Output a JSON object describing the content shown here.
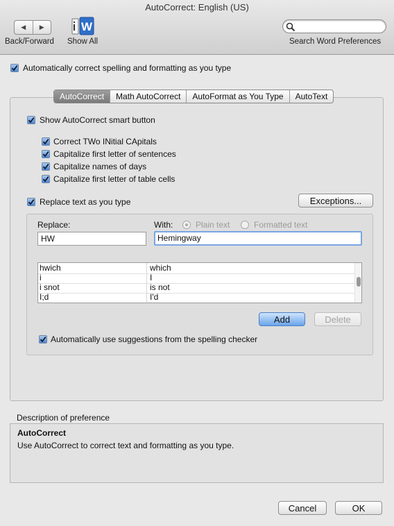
{
  "window": {
    "title": "AutoCorrect: English (US)"
  },
  "toolbar": {
    "back_forward_label": "Back/Forward",
    "back_glyph": "◀",
    "forward_glyph": "▶",
    "show_all_label": "Show All",
    "search_placeholder": "",
    "search_label": "Search Word Preferences"
  },
  "auto_correct_master": {
    "label": "Automatically correct spelling and formatting as you type",
    "checked": true
  },
  "tabs": [
    {
      "label": "AutoCorrect",
      "active": true
    },
    {
      "label": "Math AutoCorrect",
      "active": false
    },
    {
      "label": "AutoFormat as You Type",
      "active": false
    },
    {
      "label": "AutoText",
      "active": false
    }
  ],
  "options": {
    "show_smart_button": {
      "label": "Show AutoCorrect smart button",
      "checked": true
    },
    "items": [
      {
        "label": "Correct TWo INitial CApitals",
        "checked": true
      },
      {
        "label": "Capitalize first letter of sentences",
        "checked": true
      },
      {
        "label": "Capitalize names of days",
        "checked": true
      },
      {
        "label": "Capitalize first letter of table cells",
        "checked": true
      }
    ],
    "replace_text": {
      "label": "Replace text as you type",
      "checked": true
    },
    "exceptions_button": "Exceptions..."
  },
  "replace": {
    "replace_label": "Replace:",
    "with_label": "With:",
    "plain_text_label": "Plain text",
    "formatted_text_label": "Formatted text",
    "replace_value": "HW",
    "with_value": "Hemingway",
    "rows": [
      {
        "replace": "hwich",
        "with": "which"
      },
      {
        "replace": "i",
        "with": "I"
      },
      {
        "replace": "i snot",
        "with": "is not"
      },
      {
        "replace": "I;d",
        "with": "I'd"
      }
    ],
    "add_button": "Add",
    "delete_button": "Delete",
    "spelling_suggestions": {
      "label": "Automatically use suggestions from the spelling checker",
      "checked": true
    }
  },
  "description": {
    "section_title": "Description of preference",
    "heading": "AutoCorrect",
    "text": "Use AutoCorrect to correct text and formatting as you type."
  },
  "footer": {
    "cancel_label": "Cancel",
    "ok_label": "OK"
  },
  "colors": {
    "accent": "#4f86cf",
    "default_button": "#6aa4ea"
  }
}
